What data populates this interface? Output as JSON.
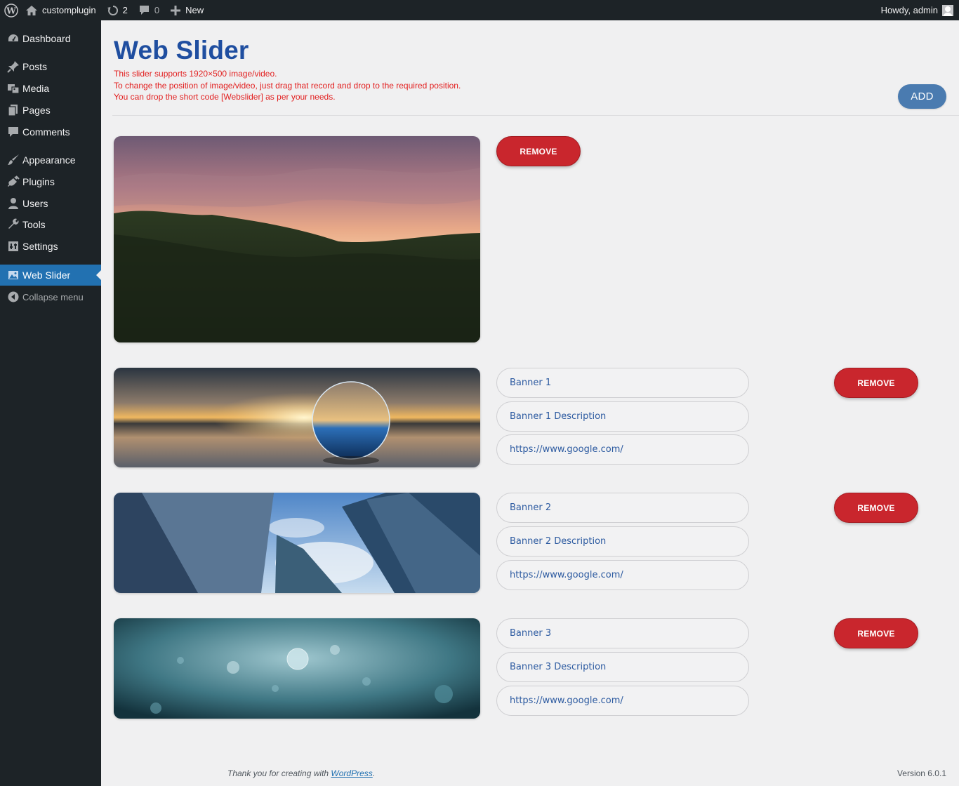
{
  "adminbar": {
    "site_name": "customplugin",
    "updates_count": "2",
    "comments_count": "0",
    "new_label": "New",
    "greeting": "Howdy, admin"
  },
  "sidebar": {
    "items": [
      {
        "label": "Dashboard",
        "icon": "dashboard-icon"
      },
      {
        "label": "Posts",
        "icon": "pin-icon"
      },
      {
        "label": "Media",
        "icon": "media-icon"
      },
      {
        "label": "Pages",
        "icon": "pages-icon"
      },
      {
        "label": "Comments",
        "icon": "comment-icon"
      },
      {
        "label": "Appearance",
        "icon": "brush-icon"
      },
      {
        "label": "Plugins",
        "icon": "plugin-icon"
      },
      {
        "label": "Users",
        "icon": "user-icon"
      },
      {
        "label": "Tools",
        "icon": "wrench-icon"
      },
      {
        "label": "Settings",
        "icon": "settings-icon"
      },
      {
        "label": "Web Slider",
        "icon": "image-icon",
        "active": true
      },
      {
        "label": "Collapse menu",
        "icon": "collapse-icon"
      }
    ]
  },
  "page": {
    "title": "Web Slider",
    "notices": [
      "This slider supports 1920×500 image/video.",
      "To change the position of image/video, just drag that record and drop to the required position.",
      "You can drop the short code [Webslider] as per your needs."
    ],
    "add_label": "ADD",
    "remove_label": "REMOVE"
  },
  "slides": [
    {
      "image": "sunset-forest",
      "title": "",
      "description": "",
      "url": ""
    },
    {
      "image": "glass-ball-sunset",
      "title": "Banner 1",
      "description": "Banner 1 Description",
      "url": "https://www.google.com/"
    },
    {
      "image": "skyscrapers",
      "title": "Banner 2",
      "description": "Banner 2 Description",
      "url": "https://www.google.com/"
    },
    {
      "image": "water-drops",
      "title": "Banner 3",
      "description": "Banner 3 Description",
      "url": "https://www.google.com/"
    }
  ],
  "footer": {
    "thanks_prefix": "Thank you for creating with ",
    "thanks_link": "WordPress",
    "thanks_suffix": ".",
    "version": "Version 6.0.1"
  },
  "colors": {
    "admin_bg": "#1d2327",
    "active_menu": "#2271b1",
    "title_blue": "#1f4ea0",
    "notice_red": "#e21f1f",
    "remove_red": "#c9262d",
    "add_blue": "#4a7bb0"
  }
}
